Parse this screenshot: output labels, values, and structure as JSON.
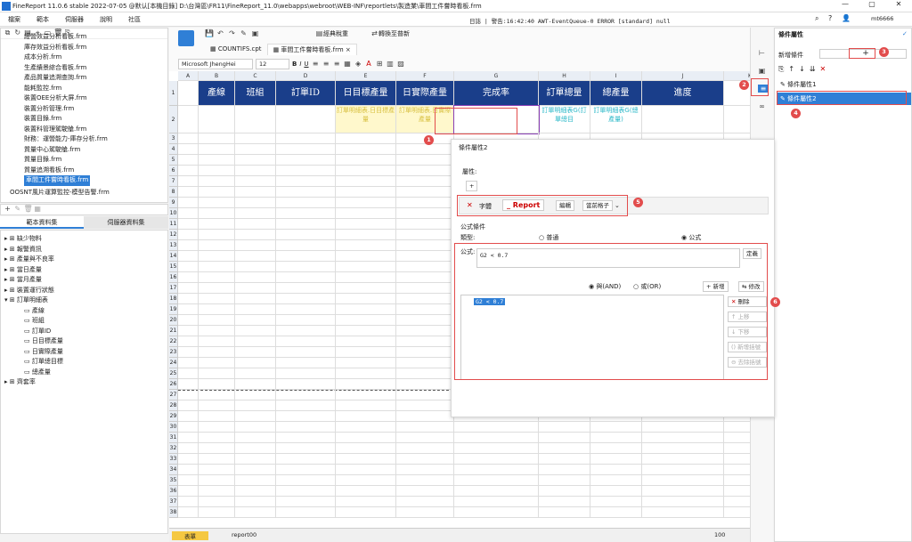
{
  "titlebar": {
    "title": "FineReport 11.0.6 stable 2022-07-05 @默认[本機目錄]    D:\\台灣區\\FR11\\FineReport_11.0\\webapps\\webroot\\WEB-INF\\reportlets\\製造業\\車間工件嘗時看板.frm",
    "minimize": "—",
    "maximize": "▢",
    "close": "✕"
  },
  "menu": [
    "檔案",
    "範本",
    "伺服器",
    "說明",
    "社區"
  ],
  "log": "日誌 | 警告:16:42:40 AWT-EventQueue-0 ERROR [standard] null",
  "user": "mt6666",
  "filetree": [
    "經營效益分析看板.frm",
    "庫存效益分析看板.frm",
    "成本分析.frm",
    "生產績景綜合看板.frm",
    "產品質量追溯查詢.frm",
    "能耗監控.frm",
    "裝置OEE分析大屏.frm",
    "裝置分析管理.frm",
    "裝置目錄.frm",
    "裝置科管理駕駛艙.frm",
    "財務：運營能力-庫存分析.frm",
    "質量中心駕駛艙.frm",
    "質量目錄.frm",
    "質量追溯看板.frm",
    "車間工件嘗時看板.frm",
    "OOSNT風片運算監控-模型告警.frm"
  ],
  "datatabs": [
    "範本資料集",
    "伺服器資料集"
  ],
  "datasets": [
    "缺少物料",
    "報警資訊",
    "產量與不良率",
    "當日產量",
    "當月產量",
    "裝置運行狀態",
    "訂單明細表"
  ],
  "fields": [
    "產線",
    "班組",
    "訂單ID",
    "日目標產量",
    "日實際產量",
    "訂單總目標",
    "總產量"
  ],
  "dataset_after": "齊套率",
  "toolbar": {
    "classic": "經典稅重",
    "convert": "轉換至普新"
  },
  "doctabs": [
    "COUNTIFS.cpt",
    "車間工件嘗時看板.frm"
  ],
  "font": "Microsoft JhengHei",
  "fontsize": "12",
  "cols": [
    "A",
    "B",
    "C",
    "D",
    "E",
    "F",
    "G",
    "H",
    "I",
    "J",
    "K"
  ],
  "headers": [
    "產線",
    "班組",
    "訂單ID",
    "日目標產量",
    "日實際產量",
    "完成率",
    "訂單總量",
    "總產量",
    "進度"
  ],
  "row2": [
    "訂單明細表.日目標產量",
    "訂單明細表.日實際產量",
    "",
    "訂單明細表G(訂單總目",
    "訂單明細表G(總產量)"
  ],
  "sheets": [
    "表單",
    "report00"
  ],
  "zoom": "100",
  "cond_dialog": {
    "title": "條件屬性2",
    "attr_label": "屬性:",
    "add": "+",
    "remove_label": "字體",
    "report_btn": "Report",
    "edit": "編輯",
    "current": "當前格子",
    "formula_section": "公式條件",
    "type_label": "類型:",
    "type_normal": "普通",
    "type_formula": "公式",
    "formula_label": "公式:",
    "formula": "G2 < 0.7",
    "define": "定義",
    "and": "與(AND)",
    "or": "或(OR)",
    "add_btn": "新增",
    "modify": "修改",
    "list_item": "G2 < 0.7",
    "delete": "刪除",
    "up": "上移",
    "down": "下移",
    "add_bracket": "新增括號",
    "remove_bracket": "去除括號"
  },
  "right": {
    "title": "條件屬性",
    "new": "新增條件",
    "items": [
      "條件屬性1",
      "條件屬性2"
    ]
  },
  "badges": [
    "1",
    "2",
    "3",
    "4",
    "5",
    "6"
  ]
}
